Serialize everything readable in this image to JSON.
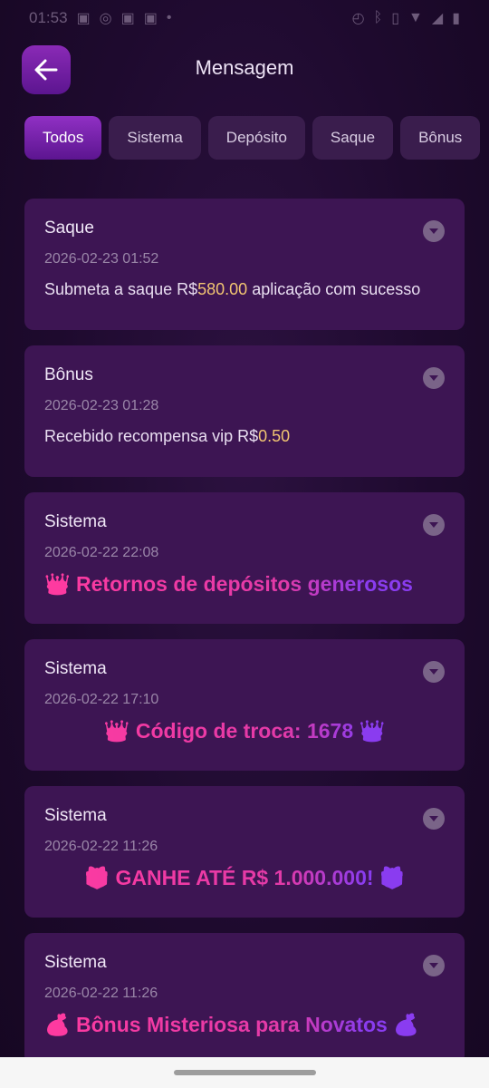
{
  "status_bar": {
    "time": "01:53",
    "left_icons": [
      "facebook-icon",
      "whatsapp-icon",
      "facebook-icon",
      "facebook-icon",
      "dot-icon"
    ],
    "right_icons": [
      "alarm-icon",
      "bluetooth-icon",
      "vibrate-icon",
      "wifi-icon",
      "signal-icon",
      "battery-icon"
    ]
  },
  "header": {
    "title": "Mensagem"
  },
  "tabs": [
    {
      "label": "Todos",
      "active": true
    },
    {
      "label": "Sistema",
      "active": false
    },
    {
      "label": "Depósito",
      "active": false
    },
    {
      "label": "Saque",
      "active": false
    },
    {
      "label": "Bônus",
      "active": false
    }
  ],
  "messages": [
    {
      "title": "Saque",
      "date": "2026-02-23 01:52",
      "body_prefix": "Submeta a saque R$",
      "amount": "580.00",
      "body_suffix": " aplicação com sucesso"
    },
    {
      "title": "Bônus",
      "date": "2026-02-23 01:28",
      "body_prefix": "Recebido recompensa vip R$",
      "amount": "0.50",
      "body_suffix": ""
    },
    {
      "title": "Sistema",
      "date": "2026-02-22 22:08",
      "promo": "👑 Retornos de depósitos generosos"
    },
    {
      "title": "Sistema",
      "date": "2026-02-22 17:10",
      "promo": "👑 Código de troca: 1678 👑"
    },
    {
      "title": "Sistema",
      "date": "2026-02-22 11:26",
      "promo": "🎁 GANHE ATÉ R$ 1.000.000! 🎁"
    },
    {
      "title": "Sistema",
      "date": "2026-02-22 11:26",
      "promo": "💰 Bônus Misteriosa para Novatos 💰"
    }
  ],
  "colors": {
    "background": "#1e0a2e",
    "card": "#3d1553",
    "accent": "#9030c4",
    "amount": "#f2c572",
    "promo_pink": "#ff3aa0",
    "promo_purple": "#8a3cf0"
  }
}
